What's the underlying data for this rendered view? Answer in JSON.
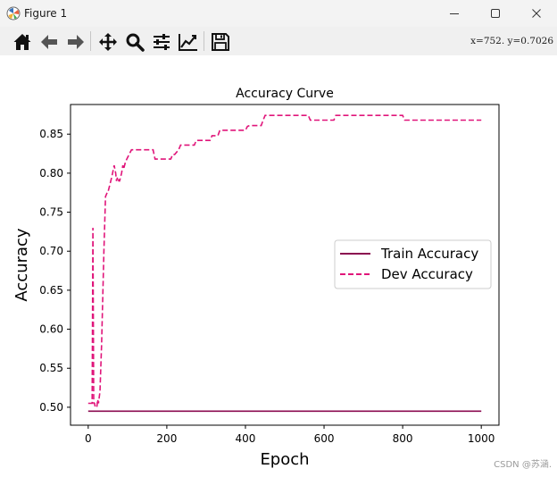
{
  "window": {
    "title": "Figure 1"
  },
  "toolbar": {
    "buttons": [
      {
        "icon": "home-icon"
      },
      {
        "icon": "back-arrow-icon"
      },
      {
        "icon": "forward-arrow-icon"
      },
      {
        "icon": "pan-move-icon"
      },
      {
        "icon": "zoom-magnifier-icon"
      },
      {
        "icon": "subplot-sliders-icon"
      },
      {
        "icon": "axes-edit-icon"
      },
      {
        "icon": "save-floppy-icon"
      }
    ],
    "coords": "x=752.  y=0.7026"
  },
  "watermark": "CSDN @苏涵.",
  "colors": {
    "train": "#8b0a50",
    "dev": "#e0157a",
    "titlebar": "#f3f3f3",
    "toolbar": "#f0f0f0"
  },
  "chart_data": {
    "type": "line",
    "title": "Accuracy Curve",
    "xlabel": "Epoch",
    "ylabel": "Accuracy",
    "xlim": [
      -45,
      1045
    ],
    "ylim": [
      0.477,
      0.888
    ],
    "xticks": [
      0,
      200,
      400,
      600,
      800,
      1000
    ],
    "yticks": [
      0.5,
      0.55,
      0.6,
      0.65,
      0.7,
      0.75,
      0.8,
      0.85
    ],
    "ytick_labels": [
      "0.50",
      "0.55",
      "0.60",
      "0.65",
      "0.70",
      "0.75",
      "0.80",
      "0.85"
    ],
    "legend": "center-right",
    "grid": false,
    "series": [
      {
        "name": "Train Accuracy",
        "style": "solid",
        "color": "#8b0a50",
        "x": [
          0,
          1000
        ],
        "y": [
          0.495,
          0.495
        ]
      },
      {
        "name": "Dev Accuracy",
        "style": "dashed",
        "color": "#e0157a",
        "x": [
          0,
          10,
          12,
          14,
          16,
          18,
          22,
          24,
          26,
          30,
          34,
          40,
          44,
          48,
          50,
          55,
          60,
          62,
          66,
          70,
          72,
          75,
          78,
          80,
          85,
          88,
          90,
          95,
          100,
          105,
          110,
          115,
          120,
          160,
          165,
          170,
          210,
          215,
          220,
          230,
          235,
          240,
          270,
          275,
          280,
          310,
          315,
          320,
          330,
          335,
          340,
          360,
          400,
          405,
          410,
          440,
          445,
          450,
          480,
          560,
          565,
          570,
          600,
          625,
          630,
          640,
          660,
          800,
          805,
          810,
          820,
          850,
          900,
          1000
        ],
        "y": [
          0.505,
          0.505,
          0.73,
          0.505,
          0.505,
          0.5,
          0.5,
          0.51,
          0.505,
          0.52,
          0.58,
          0.7,
          0.77,
          0.775,
          0.775,
          0.785,
          0.795,
          0.8,
          0.81,
          0.8,
          0.79,
          0.795,
          0.79,
          0.79,
          0.8,
          0.81,
          0.805,
          0.815,
          0.82,
          0.825,
          0.83,
          0.83,
          0.83,
          0.83,
          0.83,
          0.818,
          0.818,
          0.824,
          0.824,
          0.83,
          0.836,
          0.836,
          0.836,
          0.842,
          0.842,
          0.842,
          0.848,
          0.848,
          0.848,
          0.855,
          0.855,
          0.855,
          0.855,
          0.86,
          0.861,
          0.861,
          0.868,
          0.874,
          0.874,
          0.874,
          0.868,
          0.868,
          0.868,
          0.868,
          0.874,
          0.874,
          0.874,
          0.874,
          0.868,
          0.868,
          0.868,
          0.868,
          0.868,
          0.868
        ]
      }
    ]
  }
}
